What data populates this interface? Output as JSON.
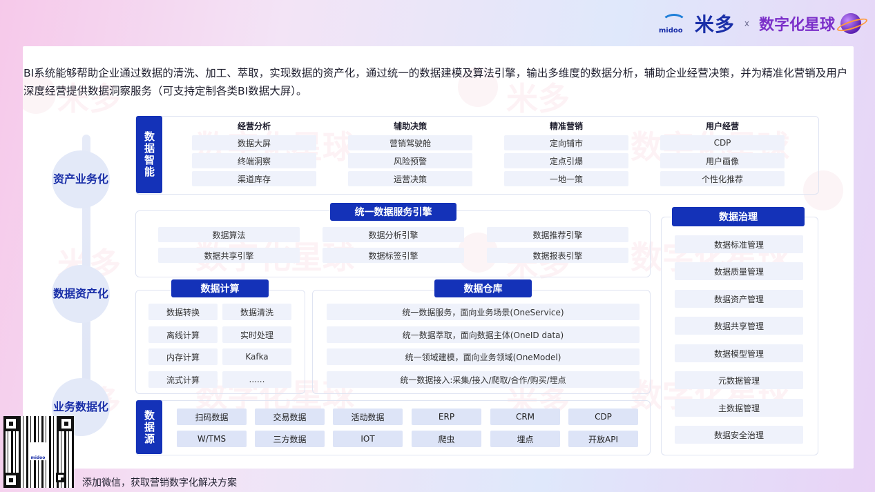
{
  "brand": {
    "logo_text": "midoo",
    "name_cn": "米多",
    "separator": "x",
    "partner": "数字化星球"
  },
  "intro": "BI系统能够帮助企业通过数据的清洗、加工、萃取，实现数据的资产化，通过统一的数据建模及算法引擎，输出多维度的数据分析，辅助企业经营决策，并为精准化营销及用户深度经营提供数据洞察服务（可支持定制各类BI数据大屏）。",
  "layers": [
    "资产业务化",
    "数据资产化",
    "业务数据化"
  ],
  "intelligence": {
    "tab": "数据智能",
    "columns": [
      {
        "header": "经营分析",
        "items": [
          "数据大屏",
          "终端洞察",
          "渠道库存"
        ]
      },
      {
        "header": "辅助决策",
        "items": [
          "营销驾驶舱",
          "风险预警",
          "运营决策"
        ]
      },
      {
        "header": "精准营销",
        "items": [
          "定向铺市",
          "定点引爆",
          "一地一策"
        ]
      },
      {
        "header": "用户经营",
        "items": [
          "CDP",
          "用户画像",
          "个性化推荐"
        ]
      }
    ]
  },
  "engine": {
    "title": "统一数据服务引擎",
    "items": [
      "数据算法",
      "数据分析引擎",
      "数据推荐引擎",
      "数据共享引擎",
      "数据标签引擎",
      "数据报表引擎"
    ]
  },
  "compute": {
    "title": "数据计算",
    "items": [
      "数据转换",
      "数据清洗",
      "离线计算",
      "实时处理",
      "内存计算",
      "Kafka",
      "流式计算",
      "......"
    ]
  },
  "warehouse": {
    "title": "数据仓库",
    "items": [
      "统一数据服务，面向业务场景(OneService)",
      "统一数据萃取，面向数据主体(OneID data)",
      "统一领域建模，面向业务领域(OneModel)",
      "统一数据接入:采集/接入/爬取/合作/购买/埋点"
    ]
  },
  "sources": {
    "tab": "数据源",
    "items": [
      "扫码数据",
      "交易数据",
      "活动数据",
      "ERP",
      "CRM",
      "CDP",
      "W/TMS",
      "三方数据",
      "IOT",
      "爬虫",
      "埋点",
      "开放API"
    ]
  },
  "governance": {
    "title": "数据治理",
    "items": [
      "数据标准管理",
      "数据质量管理",
      "数据资产管理",
      "数据共享管理",
      "数据模型管理",
      "元数据管理",
      "主数据管理",
      "数据安全治理"
    ]
  },
  "footer": "添加微信，获取营销数字化解决方案",
  "watermark": {
    "cn": "米多",
    "cn2": "数字化星球",
    "en": "midoo"
  },
  "colors": {
    "primary": "#1432b8",
    "cell_bg": "#eff2fb",
    "layer_text": "#1a2fa8"
  }
}
